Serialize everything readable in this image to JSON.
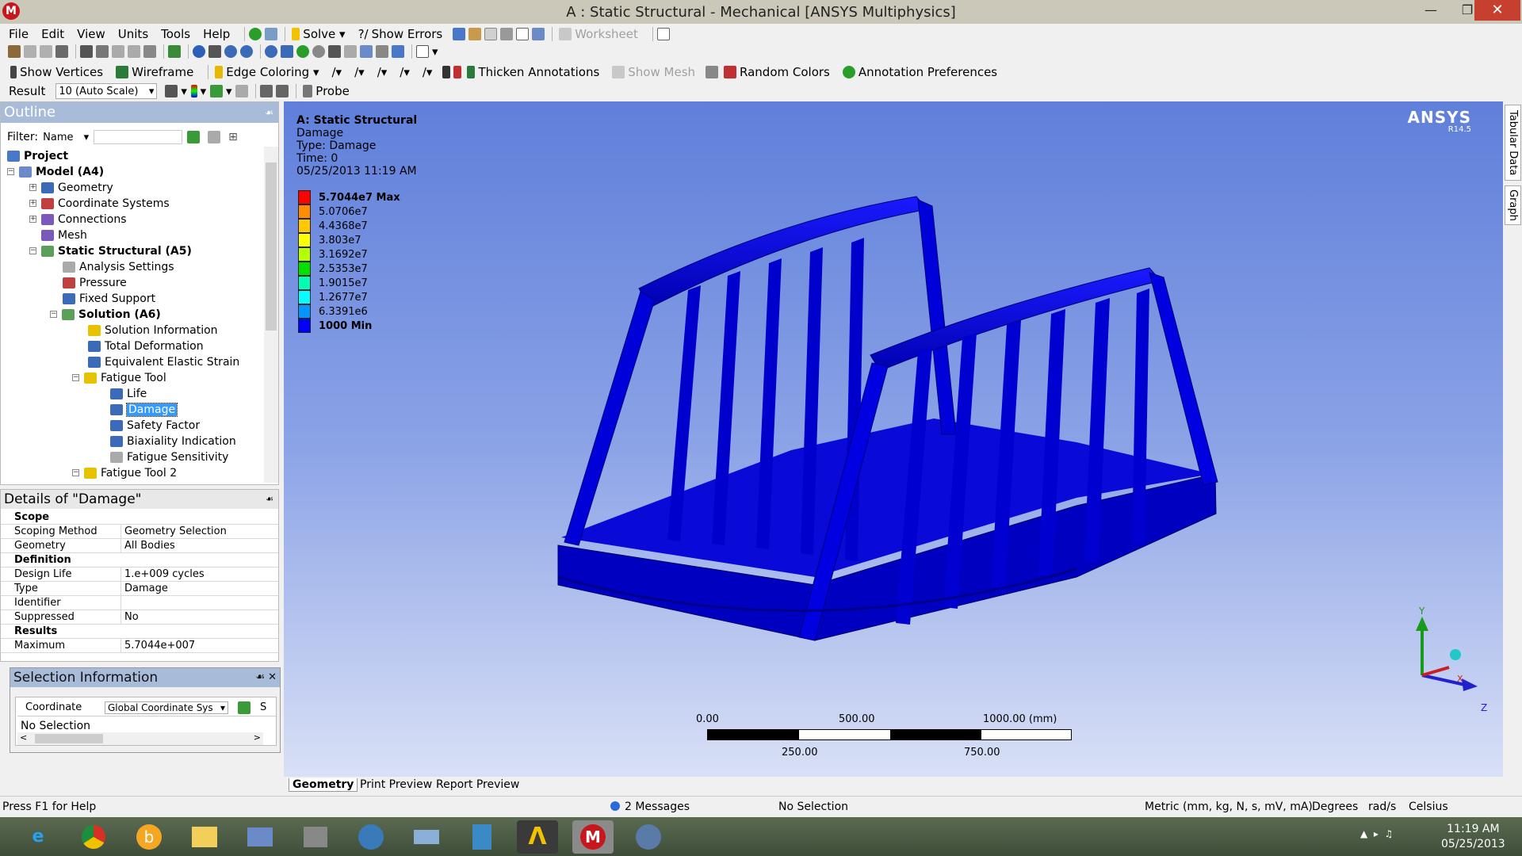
{
  "window": {
    "title": "A : Static Structural - Mechanical [ANSYS Multiphysics]",
    "app_icon": "M"
  },
  "menu": [
    "File",
    "Edit",
    "View",
    "Units",
    "Tools",
    "Help"
  ],
  "toolbar1": {
    "solve": "Solve",
    "show_errors": "Show Errors",
    "worksheet": "Worksheet"
  },
  "toolbar3": {
    "show_vertices": "Show Vertices",
    "wireframe": "Wireframe",
    "edge_coloring": "Edge Coloring",
    "thicken_annotations": "Thicken Annotations",
    "show_mesh": "Show Mesh",
    "random_colors": "Random Colors",
    "annotation_preferences": "Annotation Preferences"
  },
  "toolbar4": {
    "result_label": "Result",
    "result_scale": "10 (Auto Scale)",
    "probe": "Probe"
  },
  "outline": {
    "title": "Outline",
    "filter_label": "Filter:",
    "filter_value": "Name",
    "items": [
      {
        "label": "Project",
        "bold": true
      },
      {
        "label": "Model (A4)",
        "bold": true
      },
      {
        "label": "Geometry"
      },
      {
        "label": "Coordinate Systems"
      },
      {
        "label": "Connections"
      },
      {
        "label": "Mesh"
      },
      {
        "label": "Static Structural (A5)",
        "bold": true
      },
      {
        "label": "Analysis Settings"
      },
      {
        "label": "Pressure"
      },
      {
        "label": "Fixed Support"
      },
      {
        "label": "Solution (A6)",
        "bold": true
      },
      {
        "label": "Solution Information"
      },
      {
        "label": "Total Deformation"
      },
      {
        "label": "Equivalent Elastic Strain"
      },
      {
        "label": "Fatigue Tool"
      },
      {
        "label": "Life"
      },
      {
        "label": "Damage"
      },
      {
        "label": "Safety Factor"
      },
      {
        "label": "Biaxiality Indication"
      },
      {
        "label": "Fatigue Sensitivity"
      },
      {
        "label": "Fatigue Tool 2"
      }
    ]
  },
  "details": {
    "title": "Details of \"Damage\"",
    "rows": [
      {
        "cat": "Scope"
      },
      {
        "k": "Scoping Method",
        "v": "Geometry Selection"
      },
      {
        "k": "Geometry",
        "v": "All Bodies"
      },
      {
        "cat": "Definition"
      },
      {
        "k": "Design Life",
        "v": "1.e+009 cycles"
      },
      {
        "k": "Type",
        "v": "Damage"
      },
      {
        "k": "Identifier",
        "v": ""
      },
      {
        "k": "Suppressed",
        "v": "No"
      },
      {
        "cat": "Results"
      },
      {
        "k": "Maximum",
        "v": "5.7044e+007"
      }
    ]
  },
  "selection_info": {
    "title": "Selection Information",
    "col1": "Coordinate",
    "col2": "Global Coordinate Sys",
    "col3": "S",
    "row": "No Selection"
  },
  "viewport": {
    "header": [
      "A: Static Structural",
      "Damage",
      "Type: Damage",
      "Time: 0",
      "05/25/2013 11:19 AM"
    ],
    "brand": "ANSYS",
    "version": "R14.5",
    "legend": [
      {
        "label": "5.7044e7 Max",
        "color": "#ff0000",
        "bold": true
      },
      {
        "label": "5.0706e7",
        "color": "#ff8c00"
      },
      {
        "label": "4.4368e7",
        "color": "#ffc800"
      },
      {
        "label": "3.803e7",
        "color": "#ffff00"
      },
      {
        "label": "3.1692e7",
        "color": "#b4ff00"
      },
      {
        "label": "2.5353e7",
        "color": "#00e100"
      },
      {
        "label": "1.9015e7",
        "color": "#00ffb4"
      },
      {
        "label": "1.2677e7",
        "color": "#00ffff"
      },
      {
        "label": "6.3391e6",
        "color": "#0096ff"
      },
      {
        "label": "1000 Min",
        "color": "#0000ff",
        "bold": true
      }
    ],
    "scale": {
      "t0": "0.00",
      "t1": "250.00",
      "t2": "500.00",
      "t3": "750.00",
      "t4": "1000.00 (mm)"
    },
    "axes": {
      "x": "X",
      "y": "Y",
      "z": "Z"
    },
    "side_tabs": [
      "Tabular Data",
      "Graph"
    ]
  },
  "bottom_tabs": [
    "Geometry",
    "Print Preview",
    "Report Preview"
  ],
  "status": {
    "help": "Press F1 for Help",
    "messages": "2 Messages",
    "selection": "No Selection",
    "units": "Metric (mm, kg, N, s, mV, mA)",
    "angle": "Degrees",
    "rate": "rad/s",
    "temp": "Celsius"
  },
  "taskbar": {
    "time": "11:19 AM",
    "date": "05/25/2013"
  }
}
